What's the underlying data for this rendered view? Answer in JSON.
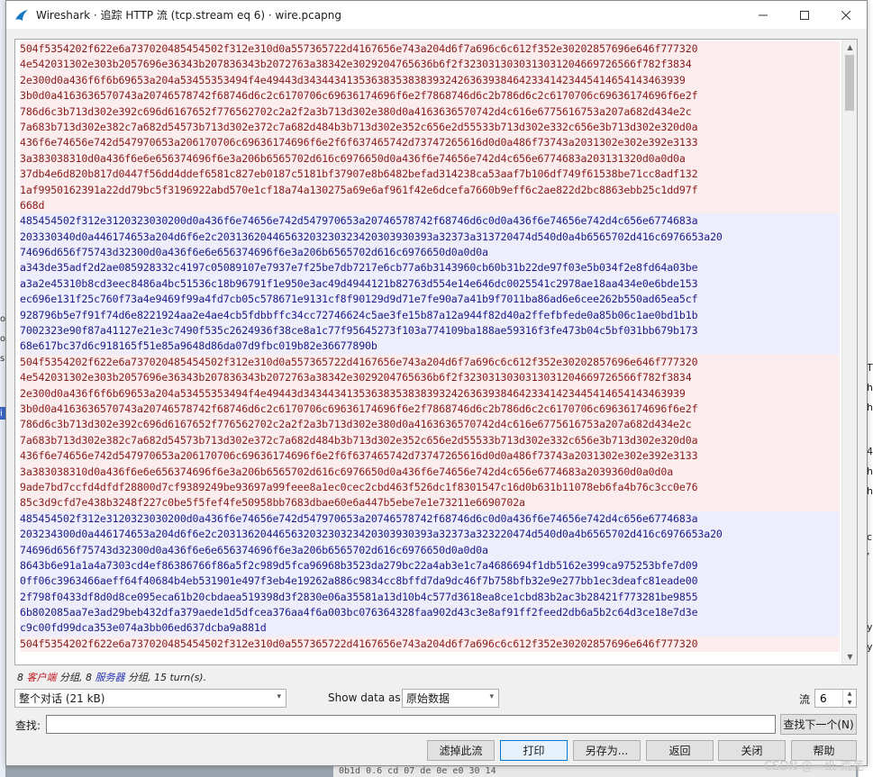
{
  "window": {
    "title": "Wireshark · 追踪 HTTP 流 (tcp.stream eq 6) · wire.pcapng",
    "minimize_icon": "minimize-icon",
    "maximize_icon": "maximize-icon",
    "close_icon": "close-icon"
  },
  "stream": {
    "lines": [
      {
        "side": "client",
        "text": "504f5354202f622e6a737020485454502f312e310d0a557365722d4167656e743a204d6f7a696c6c612f352e30202857696e646f777320"
      },
      {
        "side": "client",
        "text": "4e542031302e303b2057696e36343b207836343b2072763a38342e3029204765636b6f2f3230313030313031204669726566f782f3834"
      },
      {
        "side": "client",
        "text": "2e300d0a436f6f6b69653a204a53455353494f4e49443d34344341353638353838393242636393846423341423445414654143463939"
      },
      {
        "side": "client",
        "text": "3b0d0a4163636570743a20746578742f68746d6c2c6170706c69636174696f6e2f7868746d6c2b786d6c2c6170706c69636174696f6e2f"
      },
      {
        "side": "client",
        "text": "786d6c3b713d302e392c696d6167652f776562702c2a2f2a3b713d302e380d0a4163636570742d4c616e6775616753a207a682d434e2c"
      },
      {
        "side": "client",
        "text": "7a683b713d302e382c7a682d54573b713d302e372c7a682d484b3b713d302e352c656e2d55533b713d302e332c656e3b713d302e320d0a"
      },
      {
        "side": "client",
        "text": "436f6e74656e742d547970653a206170706c69636174696f6e2f6f637465742d73747265616d0d0a486f73743a2031302e302e392e3133"
      },
      {
        "side": "client",
        "text": "3a383038310d0a436f6e6e656374696f6e3a206b6565702d616c6976650d0a436f6e74656e742d4c656e6774683a203131320d0a0d0a"
      },
      {
        "side": "client",
        "text": "37db4e6d820b817d0447f56dd4ddef6581c827eb0187c5181bf37907e8b6482befad314238ca53aaf7b106df749f61538be71cc8adf132"
      },
      {
        "side": "client",
        "text": "1af9950162391a22dd79bc5f3196922abd570e1cf18a74a130275a69e6af961f42e6dcefa7660b9eff6c2ae822d2bc8863ebb25c1dd97f"
      },
      {
        "side": "client",
        "text": "668d"
      },
      {
        "side": "server",
        "text": "485454502f312e3120323030200d0a436f6e74656e742d547970653a20746578742f68746d6c0d0a436f6e74656e742d4c656e6774683a"
      },
      {
        "side": "server",
        "text": "203330340d0a446174653a204d6f6e2c20313620446563203230323420303930393a32373a313720474d540d0a4b6565702d416c6976653a20"
      },
      {
        "side": "server",
        "text": "74696d656f75743d32300d0a436f6e6e656374696f6e3a206b6565702d616c6976650d0a0d0a"
      },
      {
        "side": "server",
        "text": "a343de35adf2d2ae085928332c4197c05089107e7937e7f25be7db7217e6cb77a6b3143960cb60b31b22de97f03e5b034f2e8fd64a03be"
      },
      {
        "side": "server",
        "text": "a3a2e45310b8cd3eec8486a4bc51536c18b96791f1e950e3ac49d4944121b82763d554e14e646dc0025541c2978ae18aa434e0e6bde153"
      },
      {
        "side": "server",
        "text": "ec696e131f25c760f73a4e9469f99a4fd7cb05c578671e9131cf8f90129d9d71e7fe90a7a41b9f7011ba86ad6e6cee262b550ad65ea5cf"
      },
      {
        "side": "server",
        "text": "928796b5e7f91f74d6e8221924aa2e4ae4cb5fdbbffc34cc72746624c5ae3fe15b87a12a944f82d40a2ffefbfede0a85b06c1ae0bd1b1b"
      },
      {
        "side": "server",
        "text": "7002323e90f87a41127e21e3c7490f535c2624936f38ce8a1c77f95645273f103a774109ba188ae59316f3fe473b04c5bf031bb679b173"
      },
      {
        "side": "server",
        "text": "68e617bc37d6c918165f51e85a9648d86da07d9fbc019b82e36677890b"
      },
      {
        "side": "client",
        "text": "504f5354202f622e6a737020485454502f312e310d0a557365722d4167656e743a204d6f7a696c6c612f352e30202857696e646f777320"
      },
      {
        "side": "client",
        "text": "4e542031302e303b2057696e36343b207836343b2072763a38342e3029204765636b6f2f3230313030313031204669726566f782f3834"
      },
      {
        "side": "client",
        "text": "2e300d0a436f6f6b69653a204a53455353494f4e49443d34344341353638353838393242636393846423341423445414654143463939"
      },
      {
        "side": "client",
        "text": "3b0d0a4163636570743a20746578742f68746d6c2c6170706c69636174696f6e2f7868746d6c2b786d6c2c6170706c69636174696f6e2f"
      },
      {
        "side": "client",
        "text": "786d6c3b713d302e392c696d6167652f776562702c2a2f2a3b713d302e380d0a4163636570742d4c616e6775616753a207a682d434e2c"
      },
      {
        "side": "client",
        "text": "7a683b713d302e382c7a682d54573b713d302e372c7a682d484b3b713d302e352c656e2d55533b713d302e332c656e3b713d302e320d0a"
      },
      {
        "side": "client",
        "text": "436f6e74656e742d547970653a206170706c69636174696f6e2f6f637465742d73747265616d0d0a486f73743a2031302e302e392e3133"
      },
      {
        "side": "client",
        "text": "3a383038310d0a436f6e6e656374696f6e3a206b6565702d616c6976650d0a436f6e74656e742d4c656e6774683a2039360d0a0d0a"
      },
      {
        "side": "client",
        "text": "9ade7bd7ccfd4dfdf28800d7cf9389249be93697a99feee8a1ec0cec2cbd463f526dc1f8301547c16d0b631b11078eb6fa4b76c3cc0e76"
      },
      {
        "side": "client",
        "text": "85c3d9cfd7e438b3248f227c0be5f5fef4fe50958bb7683dbae60e6a447b5ebe7e1e73211e6690702a"
      },
      {
        "side": "server",
        "text": "485454502f312e3120323030200d0a436f6e74656e742d547970653a20746578742f68746d6c0d0a436f6e74656e742d4c656e6774683a"
      },
      {
        "side": "server",
        "text": "203234300d0a446174653a204d6f6e2c20313620446563203230323420303930393a32373a323220474d540d0a4b6565702d416c6976653a20"
      },
      {
        "side": "server",
        "text": "74696d656f75743d32300d0a436f6e6e656374696f6e3a206b6565702d616c6976650d0a0d0a"
      },
      {
        "side": "server",
        "text": "8643b6e91a1a4a7303cd4ef86386766f86a5f2c989d5fca96968b3523da279bc22a4ab3e1c7a4686694f1db5162e399ca975253bfe7d09"
      },
      {
        "side": "server",
        "text": "0ff06c3963466aeff64f40684b4eb531901e497f3eb4e19262a886c9834cc8bffd7da9dc46f7b758bfb32e9e277bb1ec3deafc81eade00"
      },
      {
        "side": "server",
        "text": "2f798f0433df8d0d8ce095eca61b20cbdaea519398d3f2830e06a35581a13d10b4c577d3618ea8ce1cbd83b2ac3b28421f773281be9855"
      },
      {
        "side": "server",
        "text": "6b802085aa7e3ad29beb432dfa379aede1d5dfcea376aa4f6a003bc076364328faa902d43c3e8af91ff2feed2db6a5b2c64d3ce18e7d3e"
      },
      {
        "side": "server",
        "text": "c9c00fd99dca353e074a3bb06ed637dcba9a881d"
      },
      {
        "side": "client",
        "text": "504f5354202f622e6a737020485454502f312e310d0a557365722d4167656e743a204d6f7a696c6c612f352e30202857696e646f777320"
      }
    ]
  },
  "stats": {
    "client_count": "8",
    "client_label": "客户端",
    "server_count": "8",
    "server_label": "服务器",
    "packets_word": "分组,",
    "turns": "15 turn(s)."
  },
  "controls": {
    "conversation_select": "整个对话 (21 kB)",
    "show_data_label": "Show data as",
    "data_format_select": "原始数据",
    "stream_label": "流",
    "stream_value": "6",
    "find_label": "查找:",
    "find_value": "",
    "find_next_button": "查找下一个(N)"
  },
  "buttons": {
    "filter_out": "滤掉此流",
    "print": "打印",
    "save_as": "另存为...",
    "back": "返回",
    "close": "关闭",
    "help": "帮助"
  },
  "watermark": "CSDN @一纸-荒芜",
  "background": {
    "bottom_strip": "0b1d 0.6 cd 07 de 0e e0  30 14",
    "right_frags": [
      "T",
      "h",
      "h",
      "4",
      "h",
      "h",
      "c",
      "’",
      "y",
      "y"
    ],
    "left_frags": [
      "o",
      "o",
      "s",
      "i"
    ]
  },
  "colors": {
    "client_fg": "#8a1b1b",
    "client_bg": "#fbeded",
    "server_fg": "#1b1b8a",
    "server_bg": "#ededfb"
  }
}
